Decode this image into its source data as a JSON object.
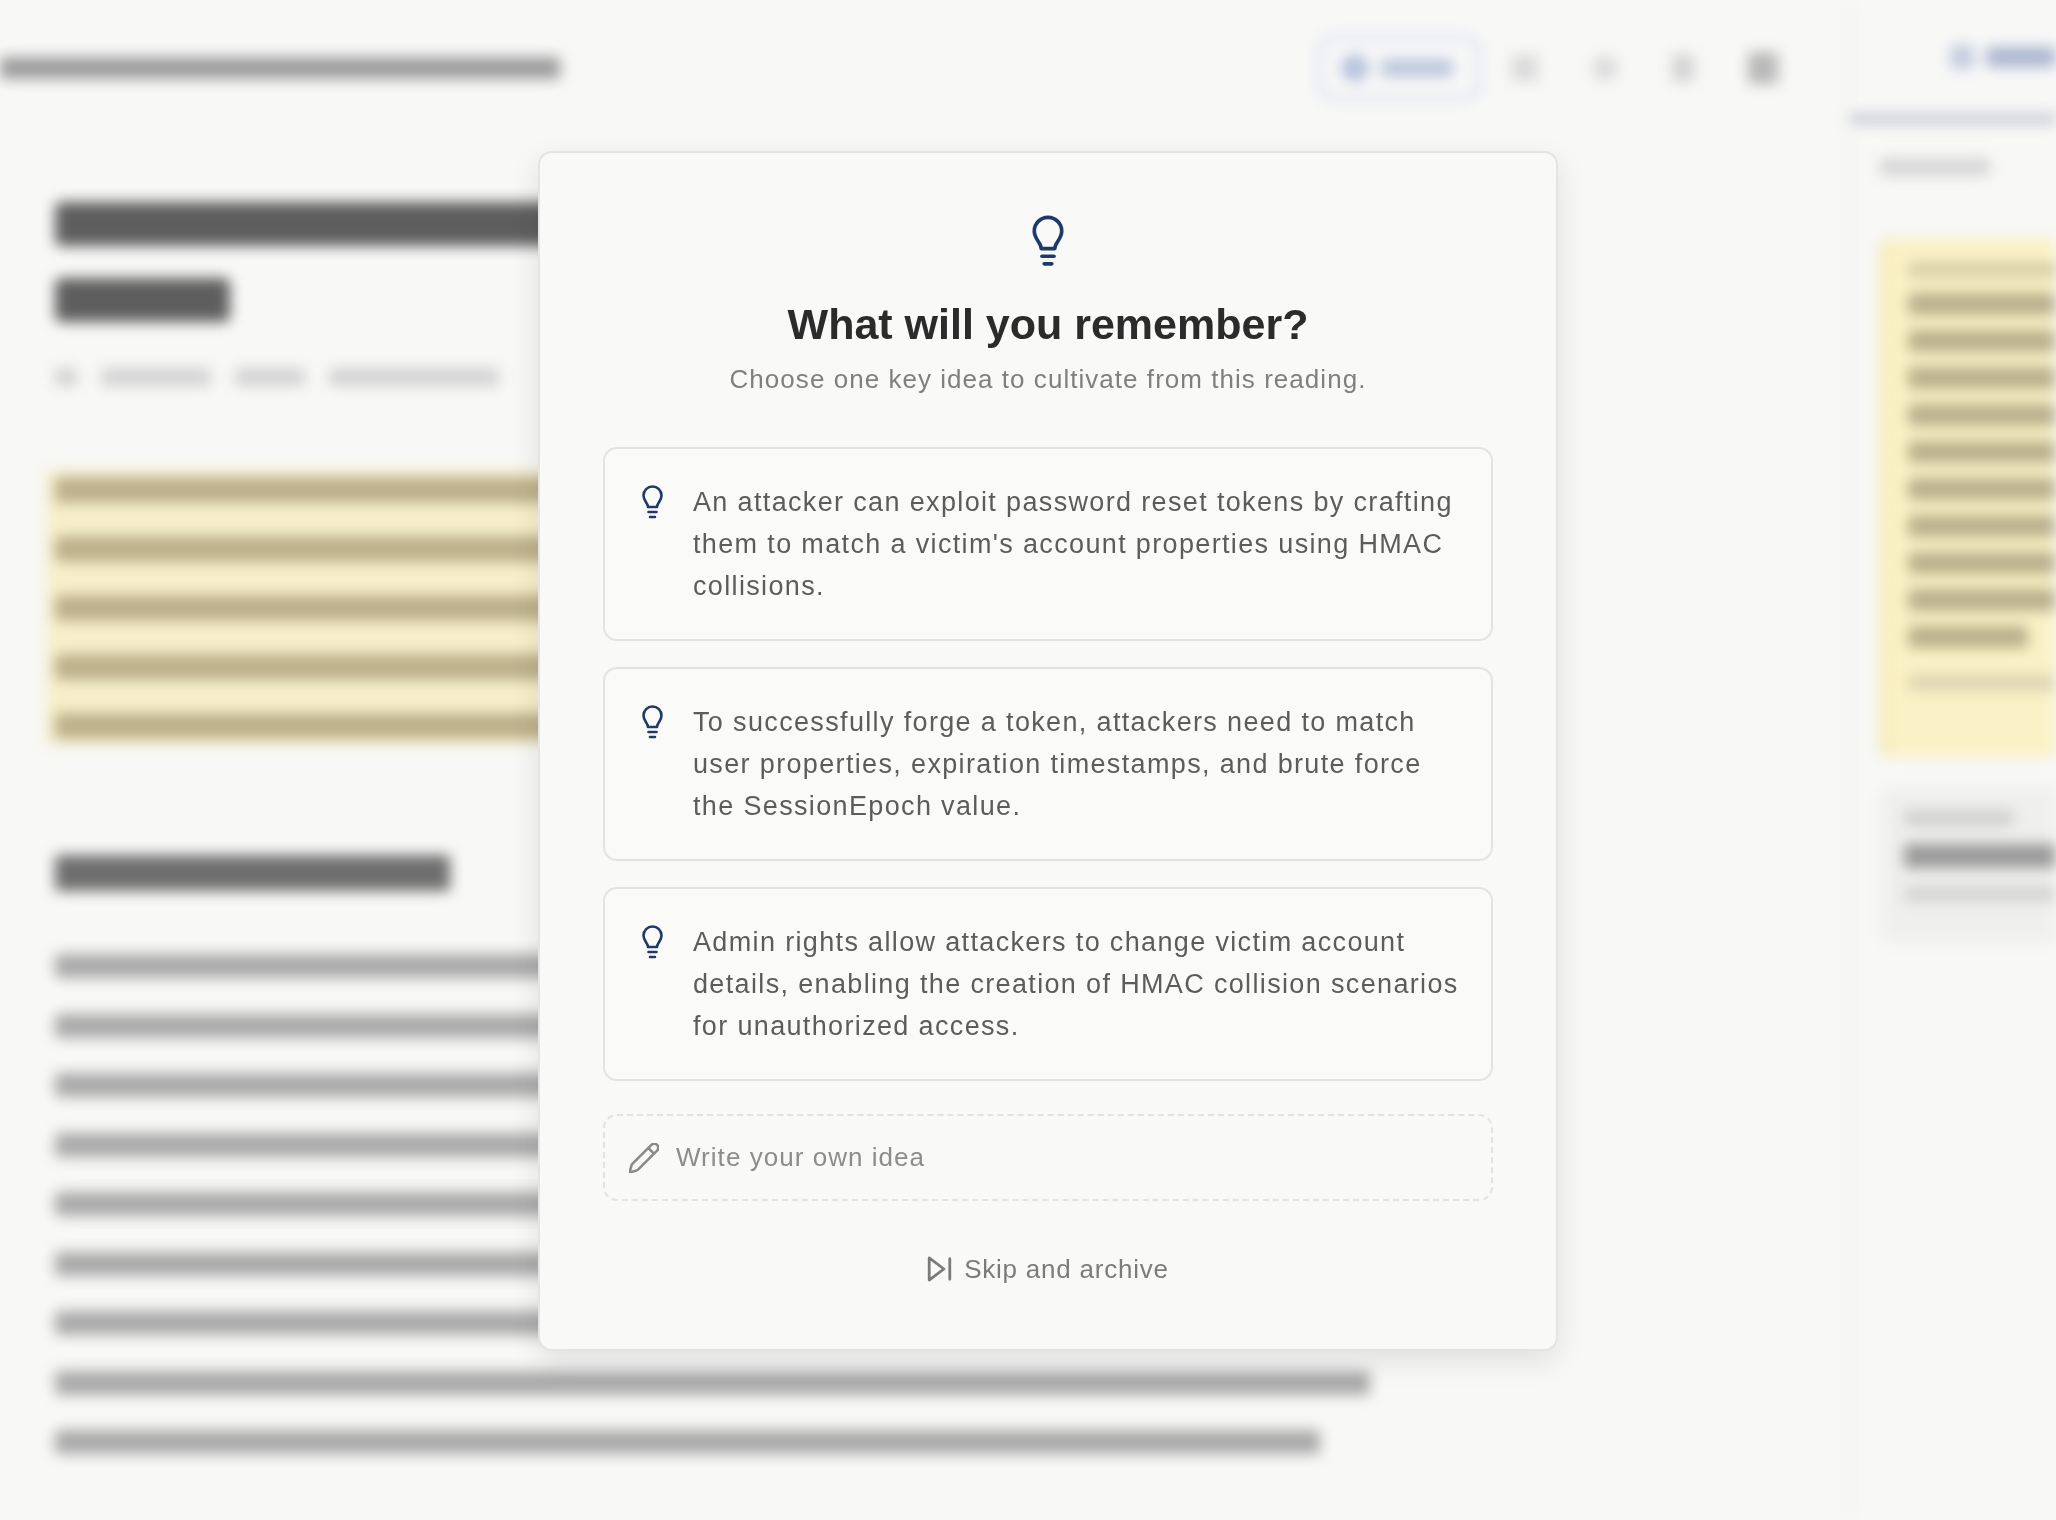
{
  "dialog": {
    "title": "What will you remember?",
    "subtitle": "Choose one key idea to cultivate from this reading.",
    "ideas": [
      {
        "text": "An attacker can exploit password reset tokens by crafting them to match a victim's account properties using HMAC collisions.",
        "selected": false
      },
      {
        "text": "To successfully forge a token, attackers need to match user properties, expiration timestamps, and brute force the SessionEpoch value.",
        "selected": false
      },
      {
        "text": "Admin rights allow attackers to change victim account details, enabling the creation of HMAC collision scenarios for unauthorized access.",
        "selected": false
      }
    ],
    "custom_idea": {
      "placeholder": "Write your own idea"
    },
    "skip_button": {
      "label": "Skip and archive"
    }
  }
}
